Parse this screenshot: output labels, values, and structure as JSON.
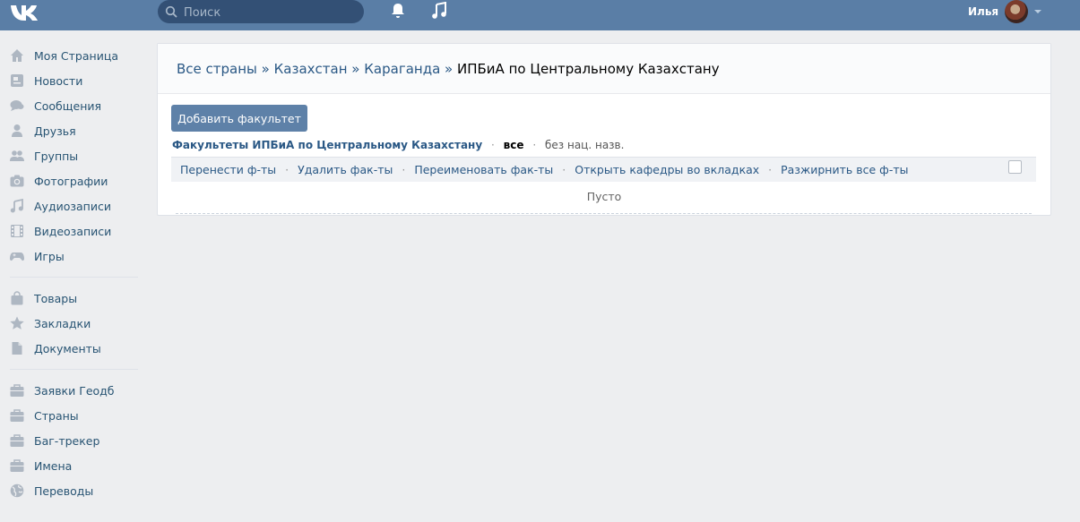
{
  "header": {
    "logo": "vk-logo",
    "search_placeholder": "Поиск",
    "user_name": "Илья"
  },
  "sidebar": {
    "group1": [
      {
        "label": "Моя Страница",
        "icon": "home-icon"
      },
      {
        "label": "Новости",
        "icon": "news-icon"
      },
      {
        "label": "Сообщения",
        "icon": "messages-icon"
      },
      {
        "label": "Друзья",
        "icon": "friend-icon"
      },
      {
        "label": "Группы",
        "icon": "groups-icon"
      },
      {
        "label": "Фотографии",
        "icon": "camera-icon"
      },
      {
        "label": "Аудиозаписи",
        "icon": "music-icon"
      },
      {
        "label": "Видеозаписи",
        "icon": "film-icon"
      },
      {
        "label": "Игры",
        "icon": "gamepad-icon"
      }
    ],
    "group2": [
      {
        "label": "Товары",
        "icon": "bag-icon"
      },
      {
        "label": "Закладки",
        "icon": "star-icon"
      },
      {
        "label": "Документы",
        "icon": "document-icon"
      }
    ],
    "group3": [
      {
        "label": "Заявки Геодб",
        "icon": "briefcase-icon"
      },
      {
        "label": "Страны",
        "icon": "briefcase-icon"
      },
      {
        "label": "Баг-трекер",
        "icon": "briefcase-icon"
      },
      {
        "label": "Имена",
        "icon": "briefcase-icon"
      },
      {
        "label": "Переводы",
        "icon": "globe-icon"
      }
    ]
  },
  "breadcrumb": {
    "items": [
      "Все страны",
      "Казахстан",
      "Караганда"
    ],
    "separator": "»",
    "current": "ИПБиА по Центральному Казахстану"
  },
  "main": {
    "add_button": "Добавить факультет",
    "filter": {
      "title": "Факультеты ИПБиА по Центральному Казахстану",
      "dot": "·",
      "all": "все",
      "no_name": "без нац. назв."
    },
    "actions": [
      "Перенести ф-ты",
      "Удалить фак-ты",
      "Переименовать фак-ты",
      "Открыть кафедры во вкладках",
      "Разжирнить все ф-ты"
    ],
    "empty_text": "Пусто"
  },
  "colors": {
    "topbar": "#5a7ea6",
    "link": "#2a5885",
    "button": "#5e81a8",
    "background": "#edeef0"
  }
}
